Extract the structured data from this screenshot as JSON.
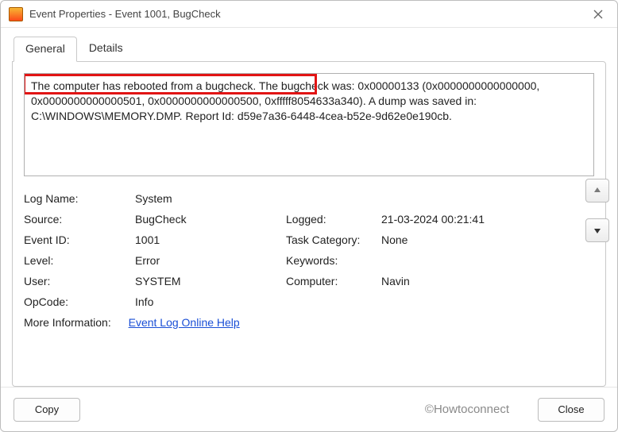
{
  "window": {
    "title": "Event Properties - Event 1001, BugCheck"
  },
  "tabs": {
    "general": "General",
    "details": "Details"
  },
  "description": {
    "text": "The computer has rebooted from a bugcheck.  The bugcheck was: 0x00000133 (0x0000000000000000, 0x0000000000000501, 0x0000000000000500, 0xfffff8054633a340). A dump was saved in: C:\\WINDOWS\\MEMORY.DMP. Report Id: d59e7a36-6448-4cea-b52e-9d62e0e190cb."
  },
  "fields": {
    "log_name_label": "Log Name:",
    "log_name_value": "System",
    "source_label": "Source:",
    "source_value": "BugCheck",
    "logged_label": "Logged:",
    "logged_value": "21-03-2024 00:21:41",
    "event_id_label": "Event ID:",
    "event_id_value": "1001",
    "task_category_label": "Task Category:",
    "task_category_value": "None",
    "level_label": "Level:",
    "level_value": "Error",
    "keywords_label": "Keywords:",
    "keywords_value": "",
    "user_label": "User:",
    "user_value": "SYSTEM",
    "computer_label": "Computer:",
    "computer_value": "Navin",
    "opcode_label": "OpCode:",
    "opcode_value": "Info",
    "more_info_label": "More Information:",
    "more_info_link": "Event Log Online Help"
  },
  "buttons": {
    "copy": "Copy",
    "close": "Close"
  },
  "watermark": "©Howtoconnect"
}
